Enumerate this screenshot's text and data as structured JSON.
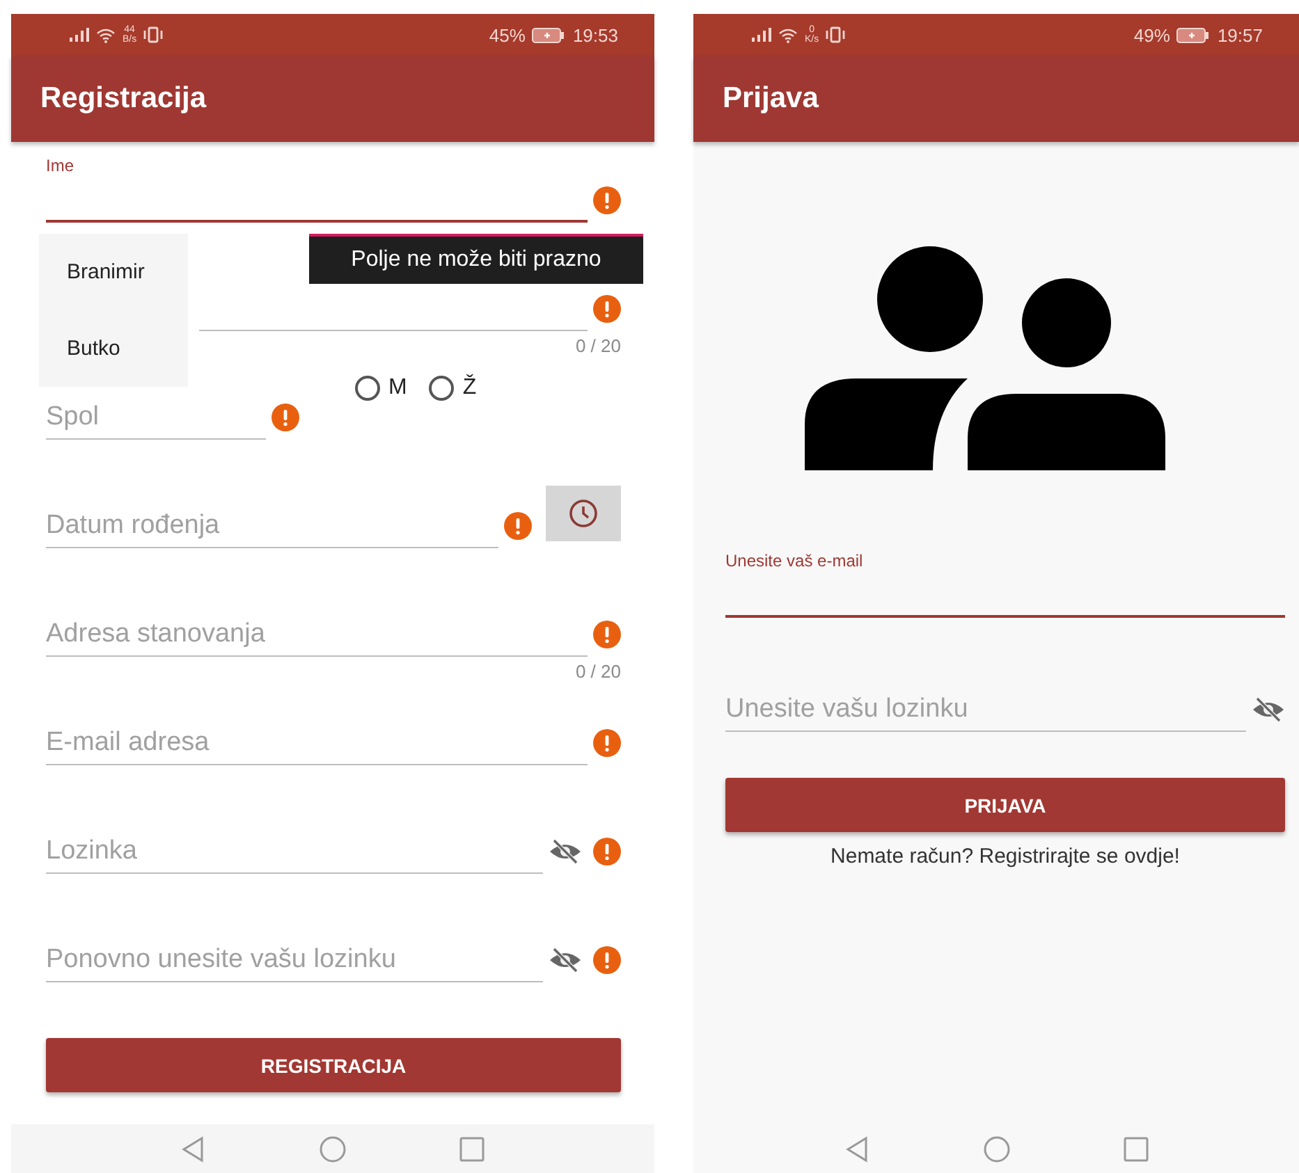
{
  "registration": {
    "status_bar": {
      "speed_value": "44",
      "speed_unit": "B/s",
      "battery": "45%",
      "time": "19:53"
    },
    "app_bar": {
      "title": "Registracija"
    },
    "fields": [
      {
        "kind": "text",
        "label": "Ime",
        "focused": true,
        "error": true
      },
      {
        "kind": "text",
        "focused": false,
        "error": true,
        "counter": "0 / 20"
      },
      {
        "kind": "gender",
        "placeholder": "Spol",
        "focused": false,
        "error": true,
        "options": [
          {
            "label": "M",
            "selected": false
          },
          {
            "label": "Ž",
            "selected": false
          }
        ]
      },
      {
        "kind": "date",
        "placeholder": "Datum rođenja",
        "focused": false,
        "error": true
      },
      {
        "kind": "text",
        "placeholder": "Adresa stanovanja",
        "focused": false,
        "error": true,
        "counter": "0 / 20"
      },
      {
        "kind": "text",
        "placeholder": "E-mail adresa",
        "focused": false,
        "error": true
      },
      {
        "kind": "password",
        "placeholder": "Lozinka",
        "focused": false,
        "error": true
      },
      {
        "kind": "password",
        "placeholder": "Ponovno unesite vašu lozinku",
        "focused": false,
        "error": true
      }
    ],
    "suggestions": [
      "Branimir",
      "Butko"
    ],
    "tooltip": "Polje ne može biti prazno",
    "button": "REGISTRACIJA"
  },
  "login": {
    "status_bar": {
      "speed_value": "0",
      "speed_unit": "K/s",
      "battery": "49%",
      "time": "19:57"
    },
    "app_bar": {
      "title": "Prijava"
    },
    "fields": [
      {
        "kind": "email",
        "label": "Unesite vaš e-mail",
        "focused": true
      },
      {
        "kind": "password",
        "placeholder": "Unesite vašu lozinku",
        "focused": false
      }
    ],
    "button": "PRIJAVA",
    "link": "Nemate račun? Registrirajte se ovdje!"
  }
}
